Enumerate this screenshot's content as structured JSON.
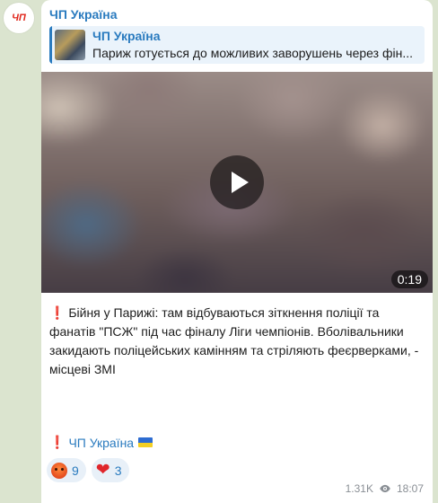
{
  "avatar": {
    "text": "ЧП"
  },
  "channel": {
    "name": "ЧП Україна"
  },
  "reply": {
    "author": "ЧП Україна",
    "text": "Париж готується до можливих заворушень через фін..."
  },
  "video": {
    "duration": "0:19"
  },
  "message": {
    "exclaim": "❗",
    "text": "Бійня у Парижі: там відбуваються зіткнення поліції та фанатів \"ПСЖ\" під час фіналу Ліги чемпіонів. Вболівальники закидають поліцейських камінням та стріляють феєрверками, - місцеві ЗМІ"
  },
  "footer": {
    "exclaim": "❗",
    "link": "ЧП Україна"
  },
  "reactions": [
    {
      "icon": "angry-face-icon",
      "count": "9"
    },
    {
      "icon": "heart-icon",
      "count": "3"
    }
  ],
  "meta": {
    "views": "1.31K",
    "time": "18:07"
  },
  "colors": {
    "accent": "#2a7bbf",
    "alert": "#e0261b",
    "background": "#dbe4cf"
  }
}
